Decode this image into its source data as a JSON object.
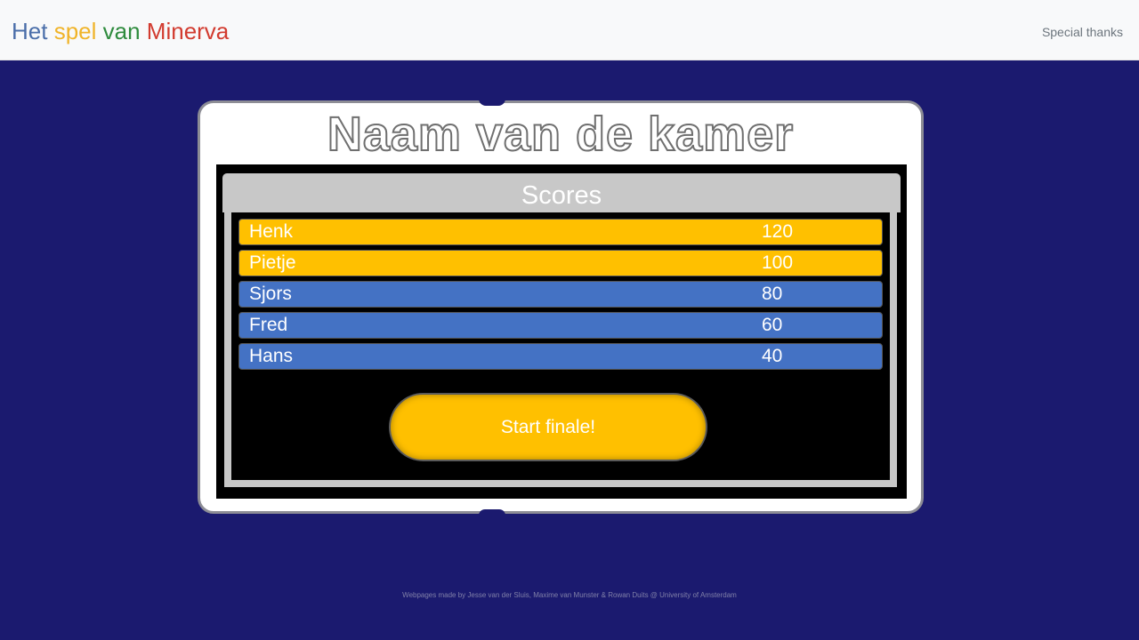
{
  "brand": {
    "words": [
      {
        "text": "Het",
        "color": "#4a6ea9"
      },
      {
        "text": "spel",
        "color": "#f0b429"
      },
      {
        "text": "van",
        "color": "#2e8b3d"
      },
      {
        "text": "Minerva",
        "color": "#d23b2f"
      }
    ]
  },
  "nav": {
    "special_thanks": "Special thanks"
  },
  "room": {
    "title": "Naam van de kamer"
  },
  "scores": {
    "title": "Scores",
    "players": [
      {
        "name": "Henk",
        "score": "120",
        "highlight": "gold"
      },
      {
        "name": "Pietje",
        "score": "100",
        "highlight": "gold"
      },
      {
        "name": "Sjors",
        "score": "80",
        "highlight": "blue"
      },
      {
        "name": "Fred",
        "score": "60",
        "highlight": "blue"
      },
      {
        "name": "Hans",
        "score": "40",
        "highlight": "blue"
      }
    ]
  },
  "actions": {
    "start_finale": "Start finale!"
  },
  "footer": {
    "credits": "Webpages made by Jesse van der Sluis, Maxime van Munster & Rowan Duits @ University of Amsterdam"
  },
  "colors": {
    "background": "#1b1a6f",
    "gold": "#ffc000",
    "blue": "#4472c4",
    "panel_gray": "#c8c8c8"
  }
}
